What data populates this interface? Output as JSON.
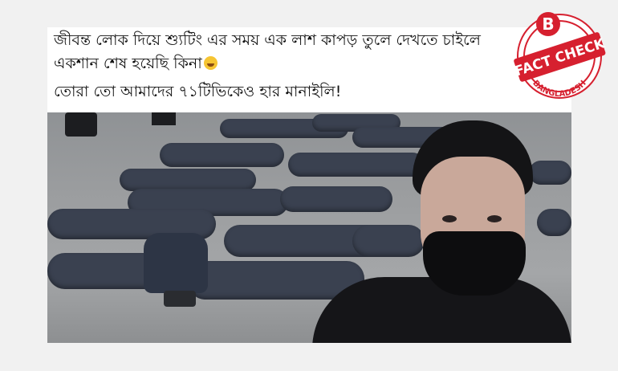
{
  "post": {
    "caption_line1": "জীবন্ত লোক দিয়ে শ্যুটিং এর সময় এক লাশ কাপড় তুলে দেখতে চাইলে",
    "caption_line2": "একশান শেষ হয়েছি কিনা",
    "caption_line3": "তোরা তো আমাদের ৭১টিভিকেও হার মানাইলি!",
    "emoji": "rolling-on-floor-laughing-emoji"
  },
  "badge": {
    "letter": "B",
    "title": "FACT CHECK",
    "subtitle": "BANGLADESH",
    "color": "#d6202f"
  }
}
